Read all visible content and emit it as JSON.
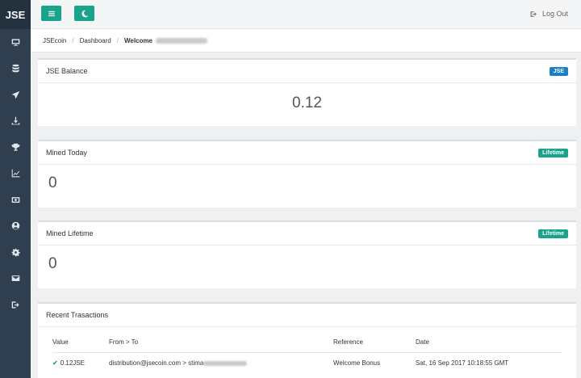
{
  "app": {
    "logo": "JSE"
  },
  "sidebar": {
    "items": [
      {
        "icon": "monitor-icon"
      },
      {
        "icon": "database-icon"
      },
      {
        "icon": "send-icon"
      },
      {
        "icon": "download-icon"
      },
      {
        "icon": "trophy-icon"
      },
      {
        "icon": "chart-icon"
      },
      {
        "icon": "money-icon"
      },
      {
        "icon": "user-circle-icon"
      },
      {
        "icon": "gear-icon"
      },
      {
        "icon": "envelope-icon"
      },
      {
        "icon": "logout-icon"
      }
    ]
  },
  "topbar": {
    "logout_label": "Log Out"
  },
  "breadcrumb": {
    "home": "JSEcoin",
    "dashboard": "Dashboard",
    "welcome": "Welcome"
  },
  "balance": {
    "title": "JSE Balance",
    "badge": "JSE",
    "value": "0.12"
  },
  "mined_today": {
    "title": "Mined Today",
    "badge": "Lifetime",
    "value": "0"
  },
  "mined_lifetime": {
    "title": "Mined Lifetime",
    "badge": "Lifetime",
    "value": "0"
  },
  "transactions": {
    "title": "Recent Trasactions",
    "columns": {
      "value": "Value",
      "from_to": "From > To",
      "reference": "Reference",
      "date": "Date"
    },
    "rows": [
      {
        "value": "0.12JSE",
        "from_to": "distribution@jsecoin.com > stima",
        "reference": "Welcome Bonus",
        "date": "Sat, 16 Sep 2017 10:18:55 GMT"
      }
    ]
  },
  "colors": {
    "sidebar": "#2f3f4f",
    "accent": "#19a38a",
    "badge_blue": "#1c7fc3"
  }
}
